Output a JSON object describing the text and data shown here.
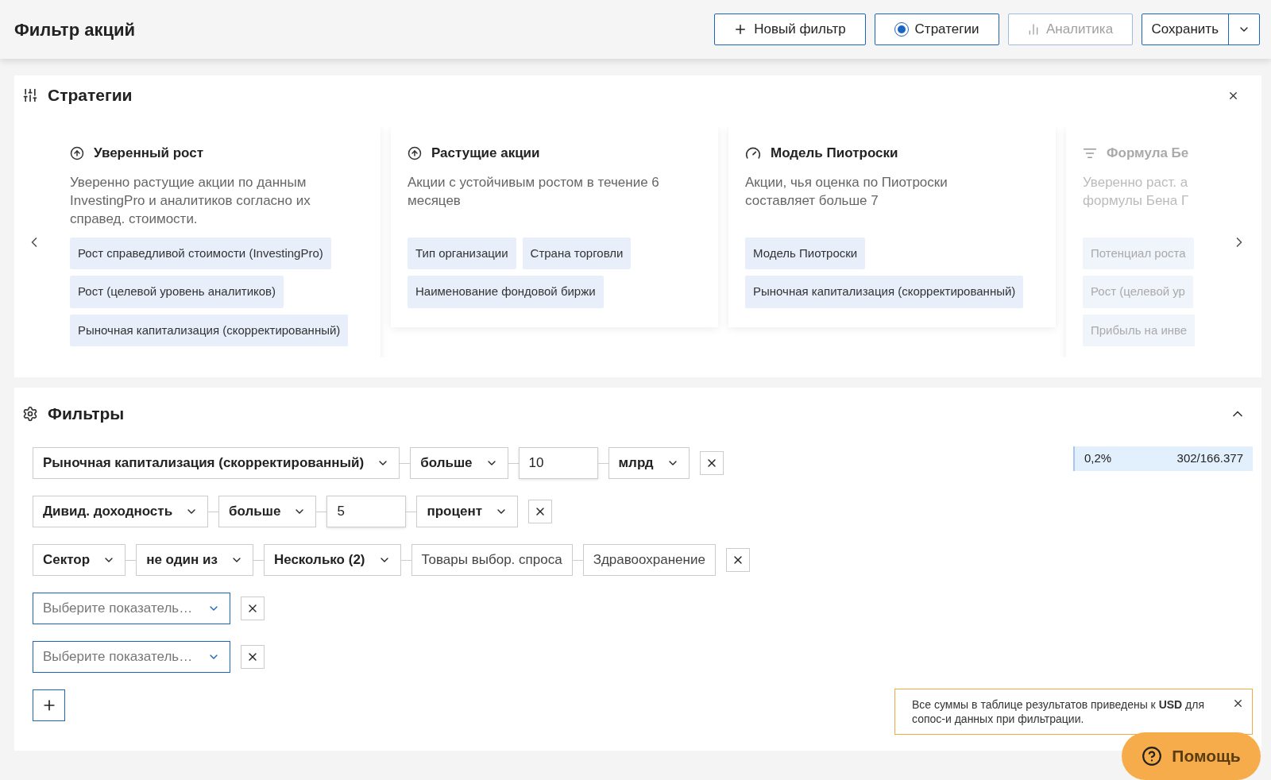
{
  "header": {
    "title": "Фильтр акций",
    "buttons": [
      {
        "kind": "new",
        "label": "Новый фильтр"
      },
      {
        "kind": "radio",
        "label": "Стратегии",
        "selected": true
      },
      {
        "kind": "analytics",
        "label": "Аналитика",
        "disabled": true
      },
      {
        "kind": "split",
        "label": "Сохранить"
      }
    ]
  },
  "strategies": {
    "title": "Стратегии",
    "cards": [
      {
        "kind": "growth",
        "clipped": false,
        "title": "Уверенный рост",
        "description": "Уверенно растущие акции по данным InvestingPro и аналитиков согласно их справед. стоимости.",
        "tags": [
          "Рост справедливой стоимости (InvestingPro)",
          "Рост (целевой уровень аналитиков)",
          "Рыночная капитализация (скорректированный)"
        ]
      },
      {
        "kind": "growth",
        "clipped": false,
        "title": "Растущие акции",
        "description": "Акции с устойчивым ростом в течение 6 месяцев",
        "tags": [
          "Тип организации",
          "Страна торговли",
          "Наименование фондовой биржи"
        ]
      },
      {
        "kind": "gauge",
        "clipped": false,
        "title": "Модель Пиотроски",
        "description": "Акции, чья оценка по Пиотроски составляет больше 7",
        "tags": [
          "Модель Пиотроски",
          "Рыночная капитализация (скорректированный)"
        ]
      },
      {
        "kind": "formula",
        "clipped": true,
        "title": "Формула Бе",
        "description": "Уверенно раст. а формулы Бена Г",
        "tags": [
          "Потенциал роста",
          "Рост (целевой ур",
          "Прибыль на инве"
        ]
      }
    ]
  },
  "filters": {
    "title": "Фильтры",
    "expanded": true,
    "rows": [
      {
        "parts": [
          {
            "kind": "select",
            "text": "Рыночная капитализация (скорректированный)"
          },
          {
            "kind": "select",
            "text": "больше"
          },
          {
            "kind": "input",
            "text": "10"
          },
          {
            "kind": "select",
            "text": "млрд"
          }
        ]
      },
      {
        "parts": [
          {
            "kind": "select",
            "text": "Дивид. доходность"
          },
          {
            "kind": "select",
            "text": "больше"
          },
          {
            "kind": "input",
            "text": "5"
          },
          {
            "kind": "select",
            "text": "процент"
          }
        ]
      },
      {
        "parts": [
          {
            "kind": "select",
            "text": "Сектор"
          },
          {
            "kind": "select",
            "text": "не один из"
          },
          {
            "kind": "select",
            "text": "Несколько (2)"
          },
          {
            "kind": "chip",
            "text": "Товары выбор. спроса"
          },
          {
            "kind": "chip",
            "text": "Здравоохранение"
          }
        ]
      },
      {
        "parts": [
          {
            "kind": "empty",
            "text": "Выберите показатель…"
          }
        ]
      },
      {
        "parts": [
          {
            "kind": "empty",
            "text": "Выберите показатель…"
          }
        ]
      }
    ],
    "result": {
      "percent": "0,2%",
      "count": "302/166.377"
    },
    "notice": "Все суммы в таблице результатов приведены к **USD** для сопос-и данных при фильтрации.",
    "help": "Помощь"
  }
}
